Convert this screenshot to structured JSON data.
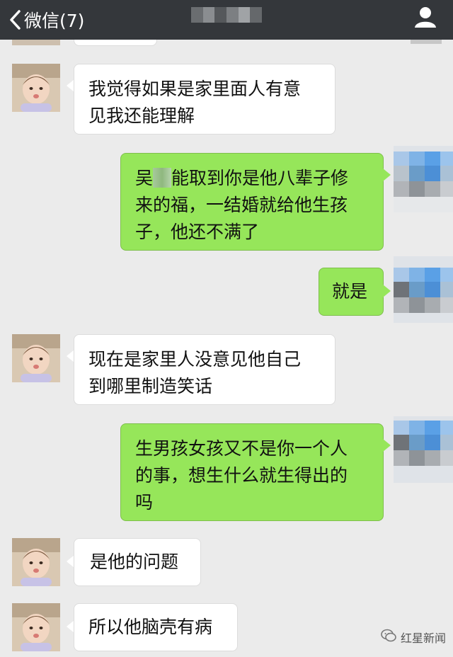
{
  "header": {
    "back_label": "微信(7)",
    "title_blurred": true
  },
  "messages": [
    {
      "side": "in",
      "text": "我觉得如果是家里面人有意\n见我还能理解"
    },
    {
      "side": "out",
      "text_pre": "吴",
      "text_post": "能取到你是他八辈子修\n来的福，一结婚就给他生孩\n子，他还不满了"
    },
    {
      "side": "out",
      "text": "就是"
    },
    {
      "side": "in",
      "text": "现在是家里人没意见他自己\n到哪里制造笑话"
    },
    {
      "side": "out",
      "text": "生男孩女孩又不是你一个人\n的事，想生什么就生得出的\n吗"
    },
    {
      "side": "in",
      "text": "是他的问题"
    },
    {
      "side": "in",
      "text": "所以他脑壳有病"
    }
  ],
  "watermark": {
    "label": "红星新闻"
  },
  "colors": {
    "topbar": "#34373b",
    "bg": "#ebebeb",
    "out_bubble": "#96e65a",
    "in_bubble": "#ffffff"
  }
}
